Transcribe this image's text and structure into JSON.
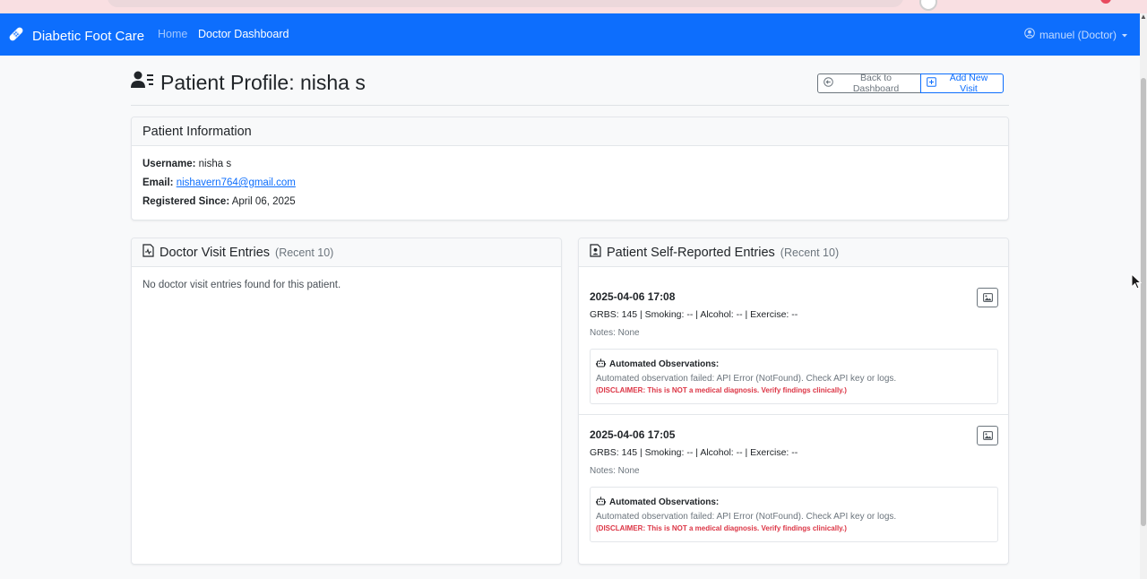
{
  "navbar": {
    "brand": "Diabetic Foot Care",
    "links": [
      {
        "label": "Home"
      },
      {
        "label": "Doctor Dashboard"
      }
    ],
    "user_menu": "manuel (Doctor)"
  },
  "page": {
    "title": "Patient Profile: nisha s",
    "back_button": "Back to Dashboard",
    "add_button": "Add New Visit"
  },
  "patient_info": {
    "header": "Patient Information",
    "username_label": "Username:",
    "username": "nisha s",
    "email_label": "Email:",
    "email": "nishavern764@gmail.com",
    "registered_label": "Registered Since:",
    "registered": "April 06, 2025"
  },
  "doctor_visits": {
    "header": "Doctor Visit Entries",
    "header_note": "(Recent 10)",
    "empty_text": "No doctor visit entries found for this patient."
  },
  "self_reported": {
    "header": "Patient Self-Reported Entries",
    "header_note": "(Recent 10)",
    "entries": [
      {
        "datetime": "2025-04-06 17:08",
        "stats": "GRBS: 145 | Smoking: -- | Alcohol: -- | Exercise: --",
        "notes": "Notes: None",
        "observations_title": "Automated Observations:",
        "observations_text": "Automated observation failed: API Error (NotFound). Check API key or logs.",
        "disclaimer": "(DISCLAIMER: This is NOT a medical diagnosis. Verify findings clinically.)"
      },
      {
        "datetime": "2025-04-06 17:05",
        "stats": "GRBS: 145 | Smoking: -- | Alcohol: -- | Exercise: --",
        "notes": "Notes: None",
        "observations_title": "Automated Observations:",
        "observations_text": "Automated observation failed: API Error (NotFound). Check API key or logs.",
        "disclaimer": "(DISCLAIMER: This is NOT a medical diagnosis. Verify findings clinically.)"
      }
    ]
  },
  "colors": {
    "navbar": "#0d6efd",
    "primary": "#0d6efd",
    "secondary": "#6c757d",
    "danger": "#dc3545",
    "page_background": "#f8f9fa"
  },
  "icons": {
    "brand": "bandage-icon",
    "user": "person-circle-icon",
    "title": "person-lines-icon",
    "back": "arrow-left-circle-icon",
    "add": "plus-square-icon",
    "visits": "file-medical-icon",
    "self_reported": "file-person-icon",
    "image": "image-icon",
    "observations": "robot-icon"
  }
}
